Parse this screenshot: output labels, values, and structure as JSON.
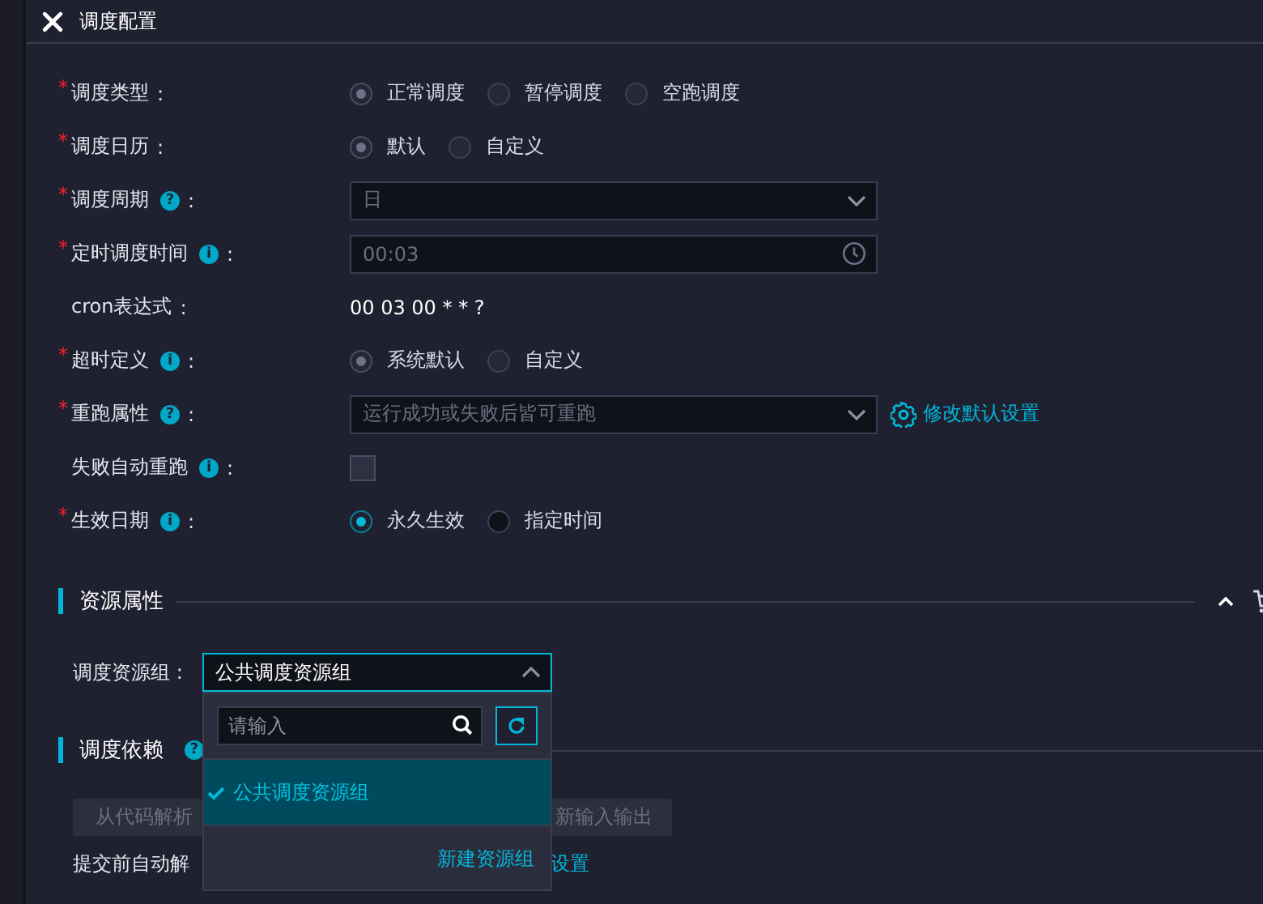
{
  "header": {
    "title": "调度配置"
  },
  "form": {
    "rows": [
      {
        "required_mark": "*",
        "label": "调度类型",
        "colon": ":",
        "kind": "radio",
        "disabled": true,
        "options": [
          {
            "label": "正常调度",
            "selected": true
          },
          {
            "label": "暂停调度",
            "selected": false
          },
          {
            "label": "空跑调度",
            "selected": false
          }
        ]
      },
      {
        "required_mark": "*",
        "label": "调度日历",
        "colon": ":",
        "kind": "radio",
        "disabled": true,
        "options": [
          {
            "label": "默认",
            "selected": true
          },
          {
            "label": "自定义",
            "selected": false
          }
        ]
      },
      {
        "required_mark": "*",
        "label": "调度周期",
        "help": "?",
        "colon": ":",
        "kind": "select",
        "disabled": true,
        "value": "日"
      },
      {
        "required_mark": "*",
        "label": "定时调度时间",
        "help": "i",
        "colon": ":",
        "kind": "time",
        "disabled": true,
        "value": "00:03"
      },
      {
        "label": "cron表达式",
        "colon": ":",
        "kind": "text",
        "value": "00 03 00 * * ?"
      },
      {
        "required_mark": "*",
        "label": "超时定义",
        "help": "i",
        "colon": ":",
        "kind": "radio",
        "disabled": true,
        "options": [
          {
            "label": "系统默认",
            "selected": true
          },
          {
            "label": "自定义",
            "selected": false
          }
        ]
      },
      {
        "required_mark": "*",
        "label": "重跑属性",
        "help": "?",
        "colon": ":",
        "kind": "select",
        "disabled": true,
        "placeholder": "运行成功或失败后皆可重跑",
        "link": "修改默认设置"
      },
      {
        "label": "失败自动重跑",
        "help": "i",
        "colon": ":",
        "kind": "checkbox",
        "disabled": true,
        "checked": false
      },
      {
        "required_mark": "*",
        "label": "生效日期",
        "help": "i",
        "colon": ":",
        "kind": "radio",
        "disabled": false,
        "options": [
          {
            "label": "永久生效",
            "selected": true
          },
          {
            "label": "指定时间",
            "selected": false
          }
        ]
      }
    ]
  },
  "resource": {
    "title": "资源属性",
    "label": "调度资源组 :",
    "value": "公共调度资源组",
    "expanded": true,
    "dropdown": {
      "search_placeholder": "请输入",
      "options": [
        {
          "label": "公共调度资源组",
          "selected": true
        }
      ],
      "footer_link": "新建资源组"
    }
  },
  "dependency": {
    "title": "调度依赖",
    "help": "?",
    "buttons": [
      "从代码解析",
      "新输入输出"
    ],
    "auto_parse_label": "提交前自动解",
    "link": "设置"
  }
}
